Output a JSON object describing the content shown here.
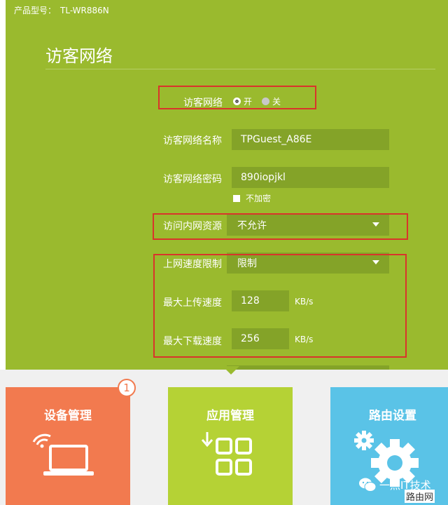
{
  "header": {
    "model_label": "产品型号：",
    "model_value": "TL-WR886N"
  },
  "page": {
    "title": "访客网络"
  },
  "form": {
    "guest_network": {
      "label": "访客网络",
      "options": [
        "开",
        "关"
      ],
      "selected": "开"
    },
    "network_name": {
      "label": "访客网络名称",
      "value": "TPGuest_A86E"
    },
    "network_password": {
      "label": "访客网络密码",
      "value": "890iopjkl"
    },
    "no_encryption": {
      "label": "不加密",
      "checked": false
    },
    "intranet_access": {
      "label": "访问内网资源",
      "value": "不允许"
    },
    "speed_limit": {
      "label": "上网速度限制",
      "value": "限制"
    },
    "max_upload": {
      "label": "最大上传速度",
      "value": "128",
      "unit": "KB/s"
    },
    "max_download": {
      "label": "最大下载速度",
      "value": "256",
      "unit": "KB/s"
    }
  },
  "tiles": [
    {
      "label": "设备管理",
      "color": "#f27a4f",
      "badge": "1",
      "icon": "laptop-wifi-icon"
    },
    {
      "label": "应用管理",
      "color": "#b5d235",
      "icon": "app-grid-icon"
    },
    {
      "label": "路由设置",
      "color": "#5ac3e7",
      "icon": "gear-icon"
    }
  ],
  "watermark": {
    "text": "一点IT技术",
    "site": "路由网",
    "icon": "wechat-icon"
  },
  "colors": {
    "panel": "#9aba2e",
    "field": "#84a328",
    "highlight": "#d9342b"
  }
}
